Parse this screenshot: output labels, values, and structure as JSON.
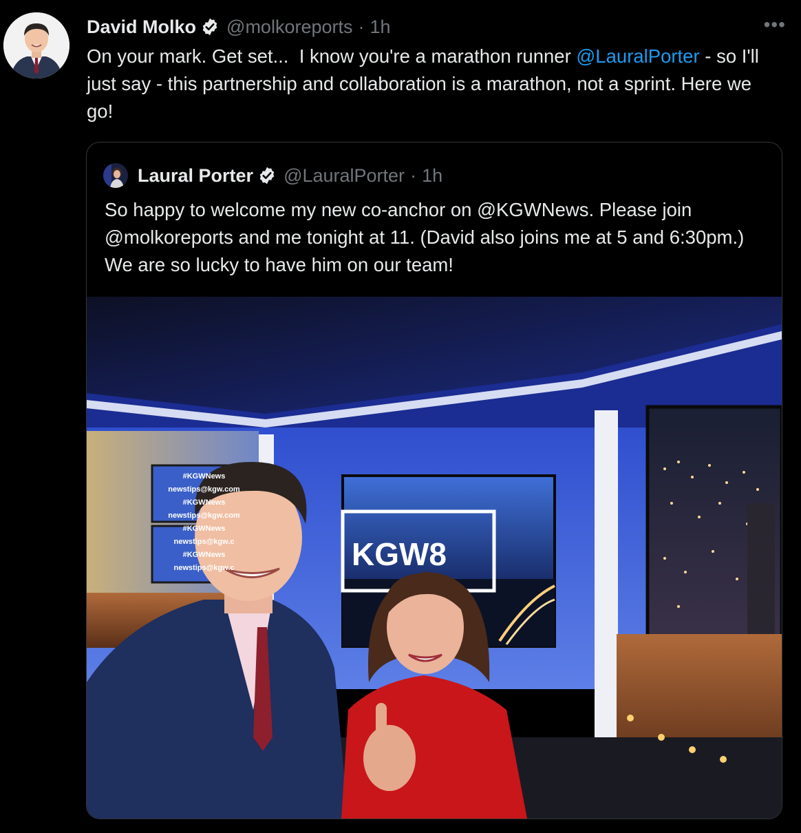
{
  "tweet": {
    "author_name": "David Molko",
    "author_handle": "@molkoreports",
    "time": "1h",
    "more_icon": "more-horizontal-icon",
    "text_parts": [
      {
        "text": "On your mark. Get set...  I know you're a marathon runner ",
        "type": "plain"
      },
      {
        "text": "@LauralPorter",
        "type": "mention"
      },
      {
        "text": " - so I'll just say - this partnership and collaboration is a marathon, not a sprint. Here we go!",
        "type": "plain"
      }
    ]
  },
  "quoted": {
    "author_name": "Laural Porter",
    "author_handle": "@LauralPorter",
    "time": "1h",
    "text": "So happy to welcome my new co-anchor on @KGWNews. Please join @molkoreports and me tonight at 11. (David also joins me at 5 and 6:30pm.) We are so lucky to have him on our team!",
    "photo": {
      "screen_logo": "KGW8",
      "ticker_lines": [
        "#KGWNews",
        "newstips@kgw.com",
        "#KGWNews",
        "newstips@kgw.com",
        "#KGWNews",
        "newstips@kgw.c",
        "#KGWNews",
        "newstips@kgw.c"
      ]
    }
  },
  "colors": {
    "background": "#000000",
    "text": "#e7e9ea",
    "muted": "#71767b",
    "link": "#1d9bf0",
    "verified": "#e7e9ea"
  }
}
